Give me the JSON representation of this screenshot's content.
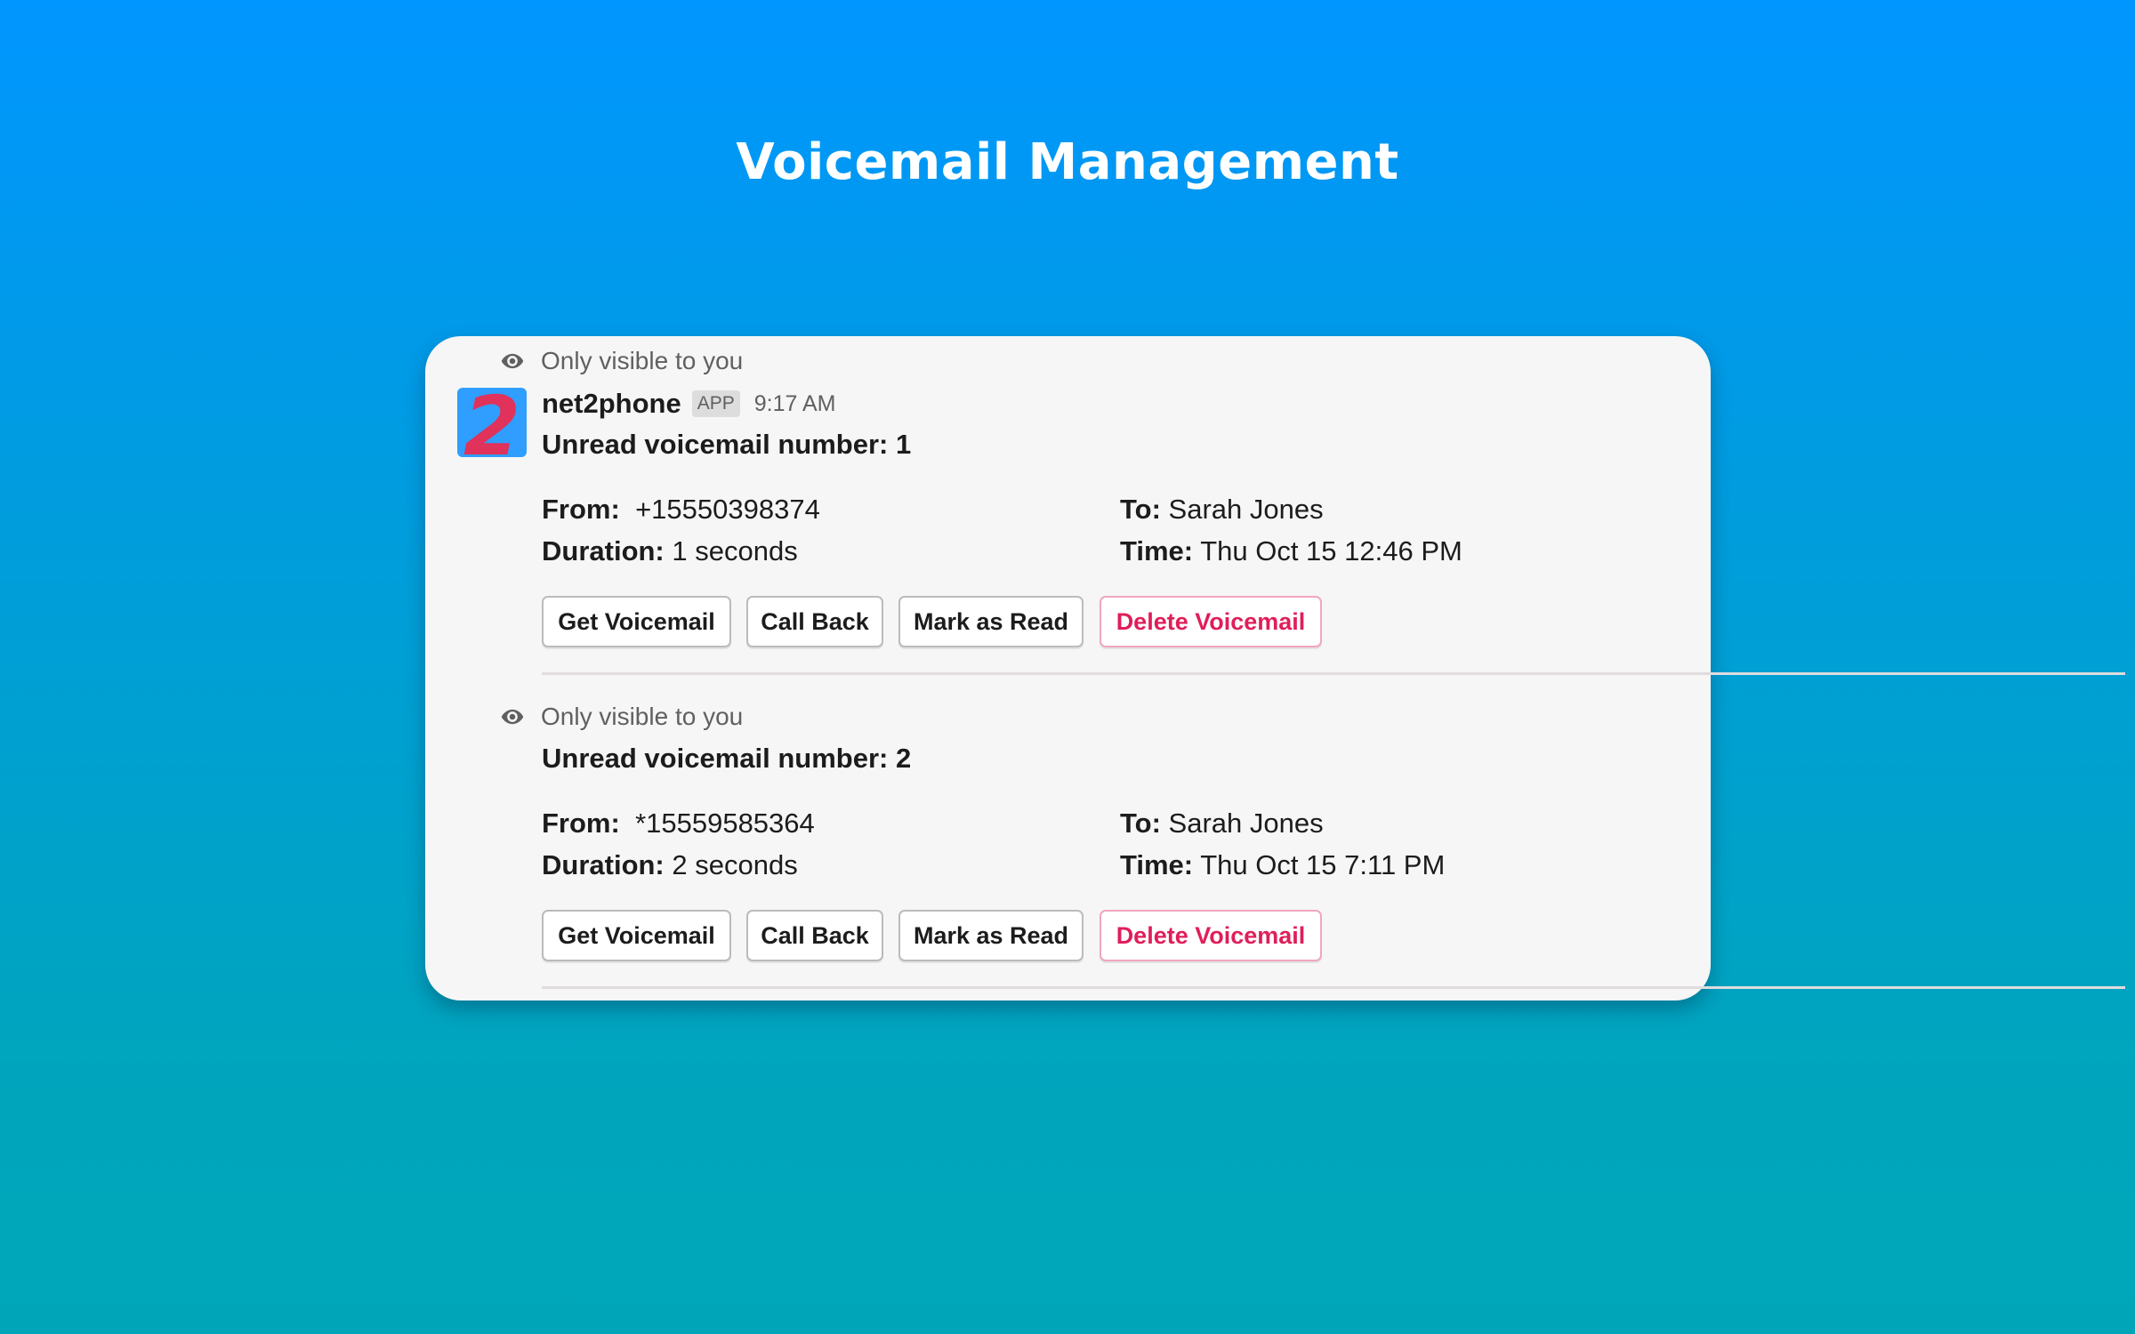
{
  "page": {
    "title": "Voicemail Management"
  },
  "app": {
    "name": "net2phone",
    "badge": "APP",
    "avatar_glyph": "2",
    "timestamp": "9:17 AM"
  },
  "visibility_note": "Only visible to you",
  "labels": {
    "from": "From:",
    "to": "To:",
    "duration": "Duration:",
    "time": "Time:"
  },
  "buttons": {
    "get_voicemail": "Get Voicemail",
    "call_back": "Call Back",
    "mark_as_read": "Mark as Read",
    "delete_voicemail": "Delete Voicemail"
  },
  "voicemails": [
    {
      "heading": "Unread voicemail number: 1",
      "from": "+15550398374",
      "to": "Sarah Jones",
      "duration": "1 seconds",
      "time": "Thu Oct 15 12:46 PM"
    },
    {
      "heading": "Unread voicemail number: 2",
      "from": "*15559585364",
      "to": "Sarah Jones",
      "duration": "2 seconds",
      "time": "Thu Oct 15 7:11 PM"
    }
  ],
  "colors": {
    "danger": "#E01E5A",
    "avatar_bg": "#2F9EFF",
    "avatar_fg": "#E0325A"
  }
}
